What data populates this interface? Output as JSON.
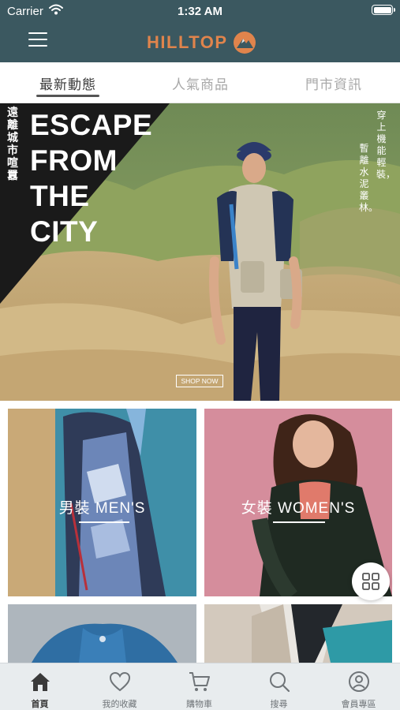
{
  "status_bar": {
    "carrier": "Carrier",
    "time": "1:32 AM"
  },
  "header": {
    "brand": "HILLTOP"
  },
  "tabs": [
    {
      "label": "最新動態",
      "active": true
    },
    {
      "label": "人氣商品",
      "active": false
    },
    {
      "label": "門市資訊",
      "active": false
    }
  ],
  "hero": {
    "headline": [
      "ESCAPE",
      "FROM",
      "THE",
      "CITY"
    ],
    "vertical_left": "遠離城市喧囂",
    "vertical_right_1": "穿上機能輕裝，",
    "vertical_right_2": "暫離水泥叢林。",
    "cta": "SHOP NOW"
  },
  "categories": [
    {
      "label": "男裝 MEN'S"
    },
    {
      "label": "女裝 WOMEN'S"
    }
  ],
  "bottom_nav": [
    {
      "label": "首頁",
      "icon": "home-icon",
      "active": true
    },
    {
      "label": "我的收藏",
      "icon": "heart-icon",
      "active": false
    },
    {
      "label": "購物車",
      "icon": "cart-icon",
      "active": false
    },
    {
      "label": "搜尋",
      "icon": "search-icon",
      "active": false
    },
    {
      "label": "會員專區",
      "icon": "user-icon",
      "active": false
    }
  ],
  "colors": {
    "header_bg": "#3b5860",
    "brand_orange": "#e0844c",
    "tab_active": "#3a3a3a",
    "tab_inactive": "#a8a8a8",
    "bottom_bar_bg": "#e8ecee"
  }
}
